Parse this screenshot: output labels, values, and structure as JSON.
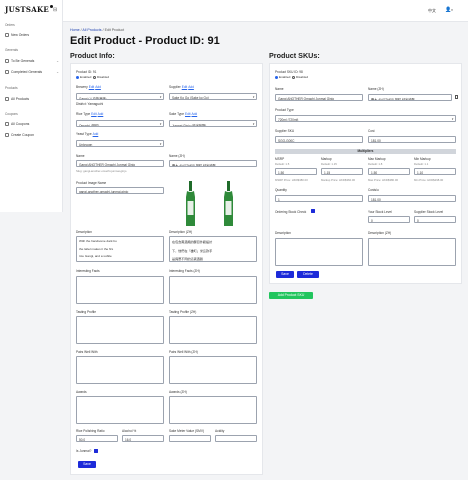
{
  "app": {
    "logo": "JUSTSAKE"
  },
  "sidebar": {
    "orders_heading": "Orders",
    "new_orders": "New Orders",
    "generals_heading": "Generals",
    "to_be_generals": "To Be Generals",
    "completed_generals": "Completed Generals",
    "products_heading": "Products",
    "all_products": "All Products",
    "coupons_heading": "Coupons",
    "all_coupons": "All Coupons",
    "create_coupon": "Create Coupon"
  },
  "topbar": {
    "lang": "中文",
    "user_caret": "▾"
  },
  "breadcrumb": {
    "home": "Home",
    "sep1": " / ",
    "all_products": "All Products",
    "sep2": " / ",
    "current": "Edit Product"
  },
  "page_title": "Edit Product - Product ID: 91",
  "product_info": {
    "heading": "Product Info:",
    "product_id_label": "Product ID: 91",
    "enabled": "Enabled",
    "disabled": "Disabled",
    "brewery_label": "Brewery",
    "brewery_value": "Gangi (八百新酒造)",
    "supplier_label": "Supplier",
    "supplier_value": "Sake Ko Go (Sake ko Go)",
    "district_label": "District: Yamaguchi",
    "rice_type_label": "Rice Type",
    "rice_type_value": "Omachi (雄町)",
    "sake_type_label": "Sake Type",
    "sake_type_value": "Junmai Ginjo (純米吟醸)",
    "yeast_type_label": "Yeast Type",
    "yeast_type_value": "Unknown",
    "edit": "Edit",
    "add": "Add",
    "name_label": "Name",
    "name_value": "Gangi ANOTHER Omachi Junmai Ginjo",
    "slug_hint": "Slug: gangi-another-omachi-junmai-ginjo",
    "name_zh_label": "Name (ZH)",
    "name_zh_value": "雁木 ANOTHER 雄町 純米吟醸",
    "image_name_label": "Product Image Name",
    "image_name_value": "gangi-another-omachi-junmai-ginjo",
    "description_label": "Description",
    "description_lines": [
      "With the handsome dark bo",
      "the label makes it the firs",
      "rice Gangi, and a subtle"
    ],
    "description_zh_label": "Description (ZH)",
    "description_zh_lines": [
      "在包含黑酒瓶的醒目外觀設計",
      "下，他們在「雄町」米這款手",
      "是與眾不同的清爽酒體"
    ],
    "interesting_facts_label": "Interesting Facts",
    "interesting_facts_zh_label": "Interesting Facts (ZH)",
    "tasting_profile_label": "Tasting Profile",
    "tasting_profile_zh_label": "Tasting Profile (ZH)",
    "pairs_well_label": "Pairs Well With",
    "pairs_well_zh_label": "Pairs Well With (ZH)",
    "awards_label": "Awards",
    "awards_zh_label": "Awards (ZH)",
    "polishing_label": "Rice Polishing Ratio",
    "polishing_value": "50.0",
    "alcohol_label": "Alcohol %",
    "alcohol_value": "16.0",
    "smv_label": "Sake Meter Value (SMV)",
    "smv_value": "",
    "acidity_label": "Acidity",
    "acidity_value": "",
    "is_junmai_label": "Is Junmai?",
    "save": "Save"
  },
  "skus": {
    "heading": "Product SKUs:",
    "sku_id_label": "Product SKU ID: 98",
    "enabled": "Enabled",
    "disabled": "Disabled",
    "name_label": "Name",
    "name_value": "Gangi ANOTHER Omachi Junmai Ginjo",
    "name_zh_label": "Name (ZH)",
    "name_zh_value": "雁木 ANOTHER 雄町 純米吟醸",
    "product_type_label": "Product Type",
    "product_type_value": "720ml (720ml)",
    "supplier_sku_label": "Supplier SKU",
    "supplier_sku_value": "SGO-G00C",
    "cost_label": "Cost",
    "cost_value": "181.00",
    "multipliers": "Multipliers",
    "msrp_label": "MSRP",
    "markup_label": "Markup",
    "max_markup_label": "Max Markup",
    "min_markup_label": "Min Markup",
    "default_hint": "Default: 1.5",
    "default_hint2": "Default: 1.15",
    "default_hint3": "Default: 1.8",
    "default_hint4": "Default: 1.1",
    "msrp_value": "1.50",
    "markup_value": "1.15",
    "max_markup_value": "1.50",
    "min_markup_value": "1.10",
    "msrp_price": "MSRP Price: HKD$380.00",
    "markup_price": "Markup Price: HKD$360.00",
    "max_price": "Max Price: HKD$380.00",
    "min_price": "Min Price: HKD$298.00",
    "quantity_label": "Quantity",
    "quantity_value": "1",
    "cost_each_label": "Costs/u",
    "cost_each_value": "181.00",
    "ordering_label": "Ordering Stock Check",
    "min_stock_label": "Your Stock Level",
    "min_stock_value": "0",
    "supplier_stock_label": "Supplier Stock Level",
    "supplier_stock_value": "0",
    "description_label": "Description",
    "description_zh_label": "Description (ZH)",
    "save": "Save",
    "delete": "Delete",
    "add_sku": "Add Product SKU"
  },
  "colors": {
    "primary": "#1d2bd9",
    "success": "#22c55e",
    "bottle": "#2f8a3a"
  }
}
